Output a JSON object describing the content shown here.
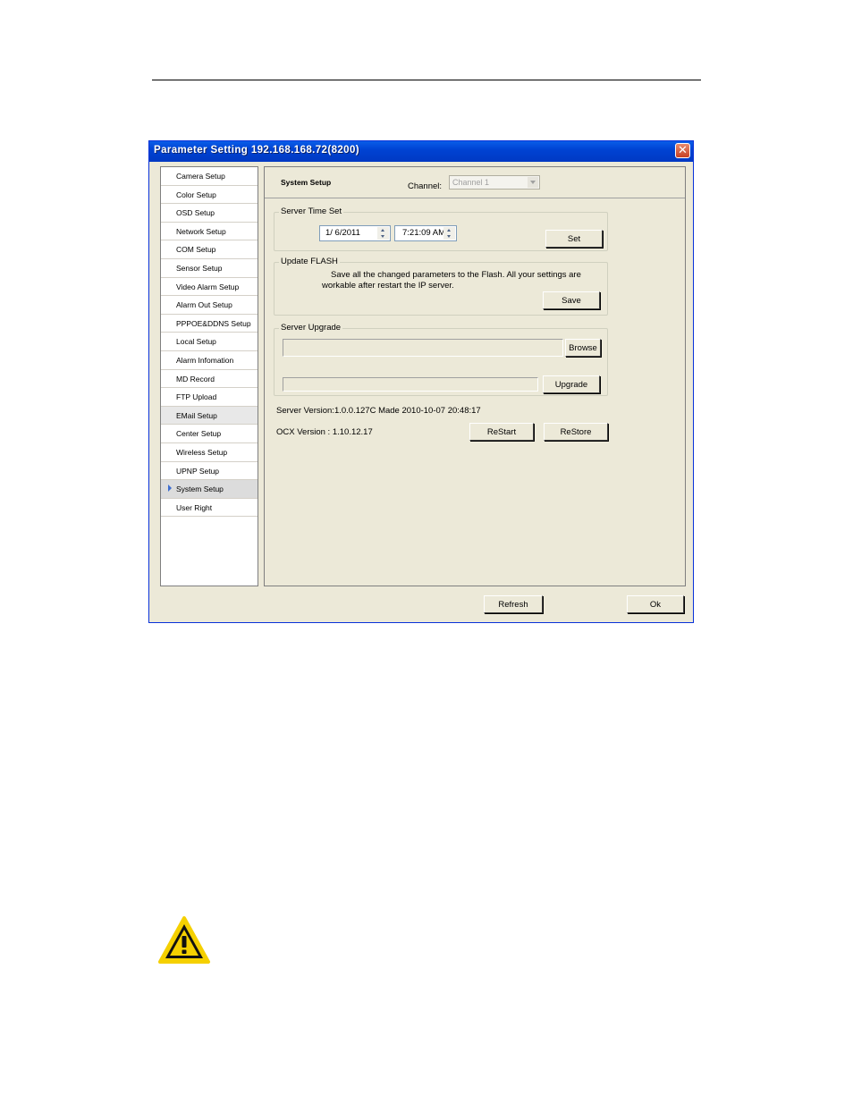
{
  "window": {
    "title": "Parameter Setting 192.168.168.72(8200)",
    "close_label": "✕"
  },
  "sidebar": {
    "items": [
      {
        "label": "Camera Setup"
      },
      {
        "label": "Color Setup"
      },
      {
        "label": "OSD Setup"
      },
      {
        "label": "Network Setup"
      },
      {
        "label": "COM Setup"
      },
      {
        "label": "Sensor Setup"
      },
      {
        "label": "Video Alarm Setup"
      },
      {
        "label": "Alarm Out Setup"
      },
      {
        "label": "PPPOE&DDNS Setup"
      },
      {
        "label": "Local Setup"
      },
      {
        "label": "Alarm Infomation"
      },
      {
        "label": "MD Record"
      },
      {
        "label": "FTP Upload"
      },
      {
        "label": "EMail Setup"
      },
      {
        "label": "Center Setup"
      },
      {
        "label": "Wireless Setup"
      },
      {
        "label": "UPNP Setup"
      },
      {
        "label": "System Setup"
      },
      {
        "label": "User Right"
      }
    ],
    "active_index": 17
  },
  "header": {
    "title": "System Setup",
    "channel_label": "Channel:",
    "channel_value": "Channel 1"
  },
  "server_time": {
    "legend": "Server Time Set",
    "date": "1/ 6/2011",
    "time": "7:21:09 AM",
    "set_label": "Set"
  },
  "update_flash": {
    "legend": "Update FLASH",
    "line1": "Save all the changed parameters to the Flash. All your settings are",
    "line2": "workable after restart the IP server.",
    "save_label": "Save"
  },
  "server_upgrade": {
    "legend": "Server Upgrade",
    "browse_label": "Browse",
    "upgrade_label": "Upgrade"
  },
  "versions": {
    "server_version": "Server Version:1.0.0.127C Made 2010-10-07 20:48:17",
    "ocx_version": "OCX Version : 1.10.12.17",
    "restart_label": "ReStart",
    "restore_label": "ReStore"
  },
  "footer": {
    "refresh_label": "Refresh",
    "ok_label": "Ok"
  },
  "colors": {
    "titlebar": "#0043d3",
    "dialog_bg": "#ece9d8",
    "warning_yellow": "#f5d000"
  }
}
